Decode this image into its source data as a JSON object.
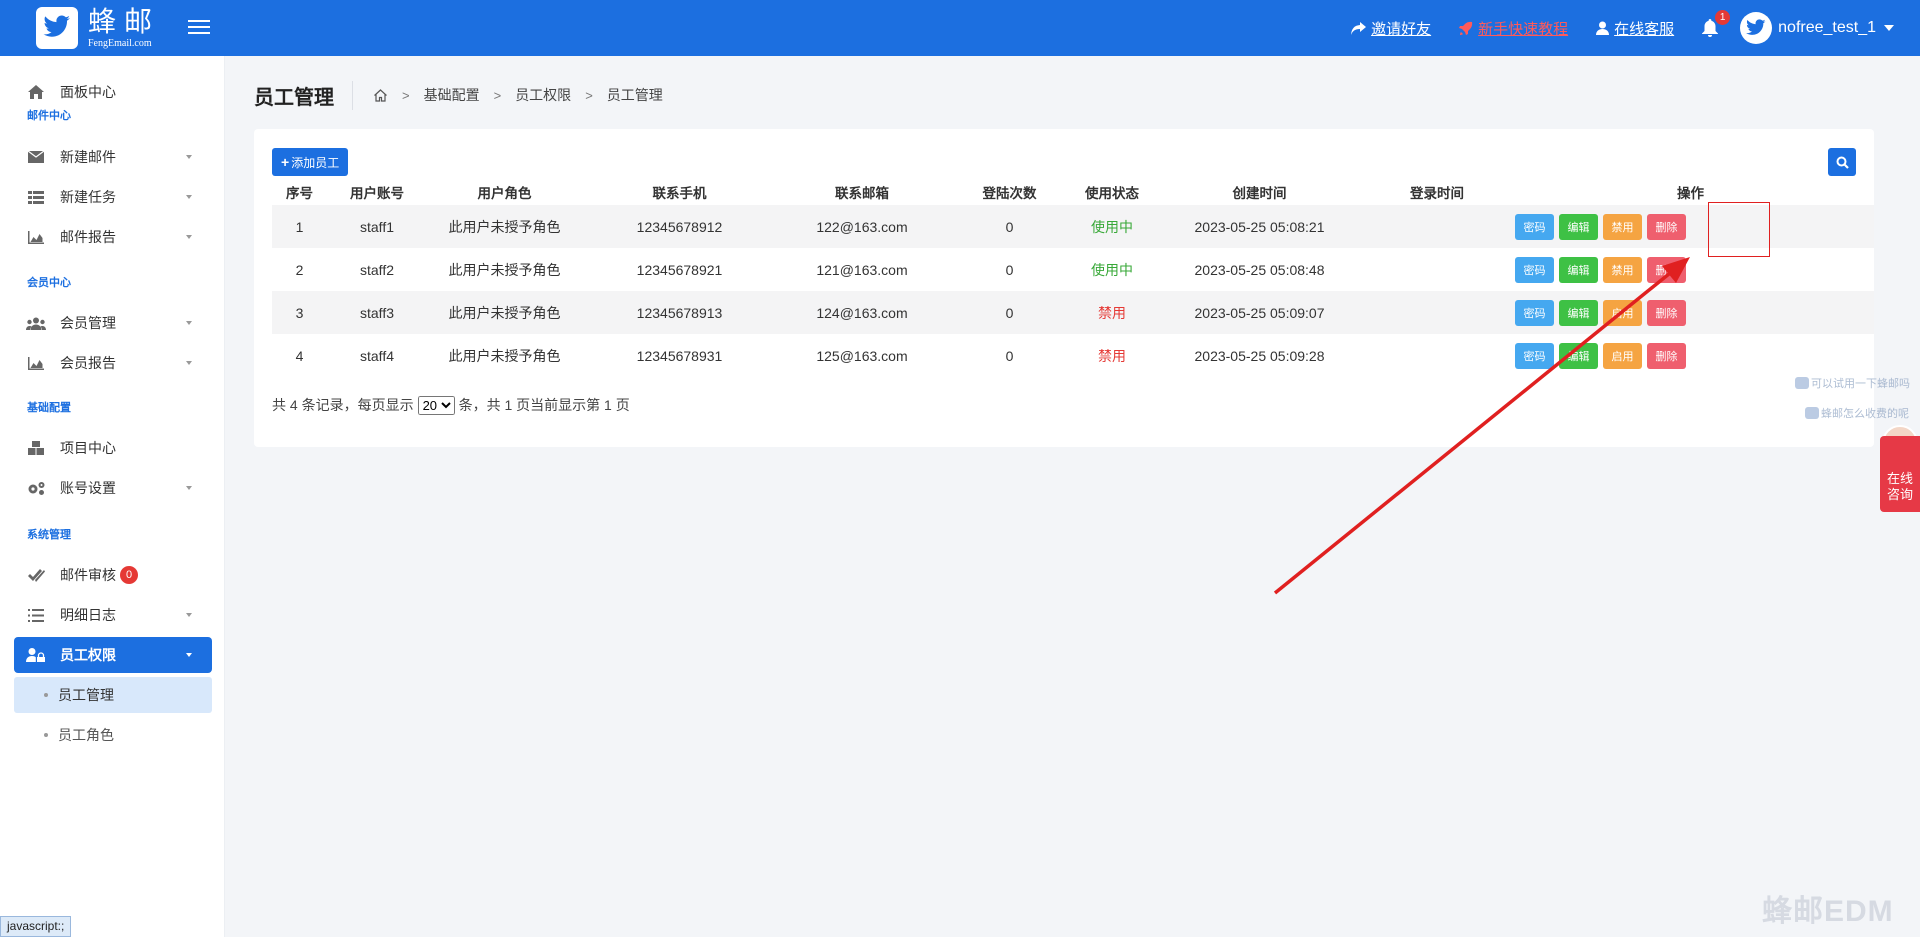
{
  "header": {
    "logo_cn": "蜂邮",
    "logo_en": "FengEmail.com",
    "links": {
      "invite": "邀请好友",
      "tutorial": "新手快速教程",
      "service": "在线客服"
    },
    "notif_count": "1",
    "username": "nofree_test_1"
  },
  "sidebar": {
    "dashboard": "面板中心",
    "sec_mail": "邮件中心",
    "new_mail": "新建邮件",
    "new_task": "新建任务",
    "mail_report": "邮件报告",
    "sec_member": "会员中心",
    "member_mgmt": "会员管理",
    "member_report": "会员报告",
    "sec_base": "基础配置",
    "project": "项目中心",
    "account": "账号设置",
    "sec_sys": "系统管理",
    "audit": "邮件审核",
    "audit_count": "0",
    "log": "明细日志",
    "staff_perm": "员工权限",
    "staff_mgmt": "员工管理",
    "staff_role": "员工角色"
  },
  "page": {
    "title": "员工管理",
    "breadcrumb": [
      "基础配置",
      "员工权限",
      "员工管理"
    ],
    "add_button": "添加员工",
    "columns": [
      "序号",
      "用户账号",
      "用户角色",
      "联系手机",
      "联系邮箱",
      "登陆次数",
      "使用状态",
      "创建时间",
      "登录时间",
      "操作"
    ],
    "rows": [
      {
        "no": "1",
        "account": "staff1",
        "role": "此用户未授予角色",
        "phone": "12345678912",
        "email": "122@163.com",
        "logins": "0",
        "status": "使用中",
        "created": "2023-05-25 05:08:21",
        "login_time": "",
        "toggle": "禁用",
        "active": true
      },
      {
        "no": "2",
        "account": "staff2",
        "role": "此用户未授予角色",
        "phone": "12345678921",
        "email": "121@163.com",
        "logins": "0",
        "status": "使用中",
        "created": "2023-05-25 05:08:48",
        "login_time": "",
        "toggle": "禁用",
        "active": true
      },
      {
        "no": "3",
        "account": "staff3",
        "role": "此用户未授予角色",
        "phone": "12345678913",
        "email": "124@163.com",
        "logins": "0",
        "status": "禁用",
        "created": "2023-05-25 05:09:07",
        "login_time": "",
        "toggle": "启用",
        "active": false
      },
      {
        "no": "4",
        "account": "staff4",
        "role": "此用户未授予角色",
        "phone": "12345678931",
        "email": "125@163.com",
        "logins": "0",
        "status": "禁用",
        "created": "2023-05-25 05:09:28",
        "login_time": "",
        "toggle": "启用",
        "active": false
      }
    ],
    "op_labels": {
      "password": "密码",
      "edit": "编辑",
      "delete": "删除"
    },
    "pager": {
      "prefix": "共 4 条记录，每页显示",
      "page_size": "20",
      "suffix": "条，共 1 页当前显示第 1 页"
    }
  },
  "float": {
    "tip1": "可以试用一下蜂邮吗",
    "tip2": "蜂邮怎么收费的呢",
    "consult": "在线咨询",
    "watermark": "蜂邮EDM"
  },
  "status_bar": "javascript:;",
  "colors": {
    "primary": "#1c6fe0",
    "ok": "#38a838",
    "danger": "#e53935"
  }
}
